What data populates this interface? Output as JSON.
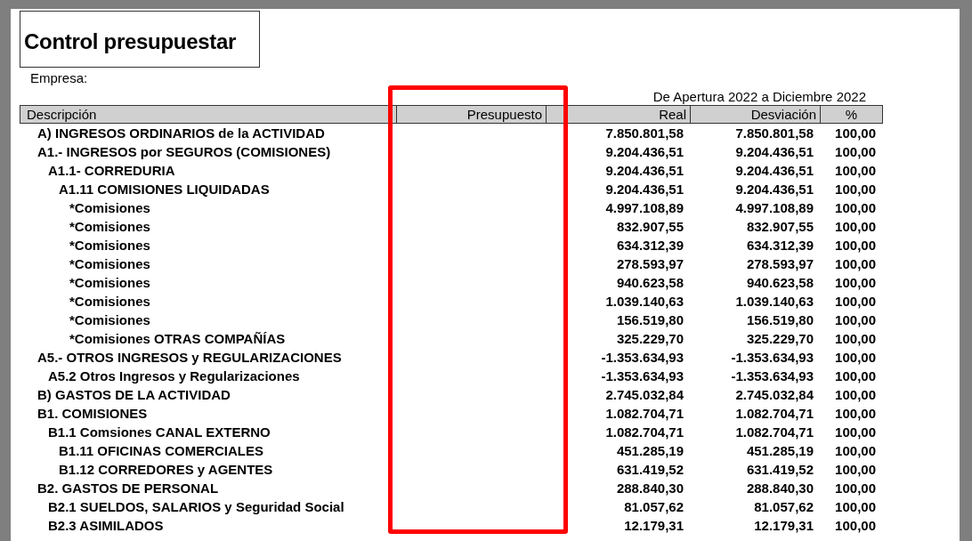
{
  "report": {
    "title": "Control presupuestar",
    "company_label": "Empresa:",
    "period": "De Apertura 2022 a Diciembre 2022"
  },
  "table": {
    "columns": [
      "Descripción",
      "Presupuesto",
      "Real",
      "Desviación",
      "%"
    ],
    "rows": [
      {
        "label": "A) INGRESOS ORDINARIOS de la ACTIVIDAD",
        "real": "7.850.801,58",
        "deviation": "7.850.801,58",
        "percent": "100,00"
      },
      {
        "label": "A1.- INGRESOS por SEGUROS (COMISIONES)",
        "real": "9.204.436,51",
        "deviation": "9.204.436,51",
        "percent": "100,00",
        "children": [
          {
            "label": "A1.1- CORREDURIA",
            "real": "9.204.436,51",
            "deviation": "9.204.436,51",
            "percent": "100,00",
            "children": [
              {
                "label": "A1.11 COMISIONES LIQUIDADAS",
                "real": "9.204.436,51",
                "deviation": "9.204.436,51",
                "percent": "100,00",
                "children": [
                  {
                    "label": "*Comisiones",
                    "real": "4.997.108,89",
                    "deviation": "4.997.108,89",
                    "percent": "100,00"
                  },
                  {
                    "label": "*Comisiones",
                    "real": "832.907,55",
                    "deviation": "832.907,55",
                    "percent": "100,00"
                  },
                  {
                    "label": "*Comisiones",
                    "real": "634.312,39",
                    "deviation": "634.312,39",
                    "percent": "100,00"
                  },
                  {
                    "label": "*Comisiones",
                    "real": "278.593,97",
                    "deviation": "278.593,97",
                    "percent": "100,00"
                  },
                  {
                    "label": "*Comisiones",
                    "real": "940.623,58",
                    "deviation": "940.623,58",
                    "percent": "100,00"
                  },
                  {
                    "label": "*Comisiones",
                    "real": "1.039.140,63",
                    "deviation": "1.039.140,63",
                    "percent": "100,00"
                  },
                  {
                    "label": "*Comisiones",
                    "real": "156.519,80",
                    "deviation": "156.519,80",
                    "percent": "100,00"
                  },
                  {
                    "label": "*Comisiones OTRAS COMPAÑÍAS",
                    "real": "325.229,70",
                    "deviation": "325.229,70",
                    "percent": "100,00"
                  }
                ]
              }
            ]
          }
        ]
      },
      {
        "label": "A5.- OTROS INGRESOS y REGULARIZACIONES",
        "real": "-1.353.634,93",
        "deviation": "-1.353.634,93",
        "percent": "100,00",
        "children": [
          {
            "label": "A5.2 Otros Ingresos y Regularizaciones",
            "real": "-1.353.634,93",
            "deviation": "-1.353.634,93",
            "percent": "100,00"
          }
        ]
      },
      {
        "label": "B) GASTOS DE LA ACTIVIDAD",
        "real": "2.745.032,84",
        "deviation": "2.745.032,84",
        "percent": "100,00"
      },
      {
        "label": "B1. COMISIONES",
        "real": "1.082.704,71",
        "deviation": "1.082.704,71",
        "percent": "100,00",
        "children": [
          {
            "label": "B1.1 Comsiones CANAL EXTERNO",
            "real": "1.082.704,71",
            "deviation": "1.082.704,71",
            "percent": "100,00",
            "children": [
              {
                "label": "B1.11 OFICINAS COMERCIALES",
                "real": "451.285,19",
                "deviation": "451.285,19",
                "percent": "100,00"
              },
              {
                "label": "B1.12 CORREDORES y AGENTES",
                "real": "631.419,52",
                "deviation": "631.419,52",
                "percent": "100,00"
              }
            ]
          }
        ]
      },
      {
        "label": "B2. GASTOS DE PERSONAL",
        "real": "288.840,30",
        "deviation": "288.840,30",
        "percent": "100,00",
        "children": [
          {
            "label": "B2.1 SUELDOS, SALARIOS y Seguridad Social",
            "real": "81.057,62",
            "deviation": "81.057,62",
            "percent": "100,00"
          },
          {
            "label": "B2.3 ASIMILADOS",
            "real": "12.179,31",
            "deviation": "12.179,31",
            "percent": "100,00"
          }
        ]
      }
    ]
  }
}
